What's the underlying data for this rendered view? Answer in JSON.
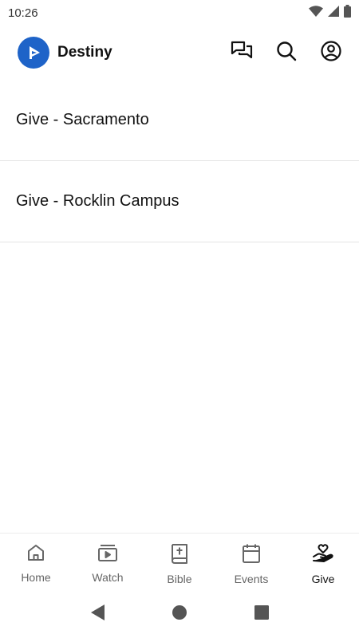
{
  "status_bar": {
    "time": "10:26"
  },
  "header": {
    "app_name": "Destiny"
  },
  "giving_options": [
    {
      "label": "Give - Sacramento"
    },
    {
      "label": "Give - Rocklin Campus"
    }
  ],
  "bottom_nav": {
    "items": [
      {
        "label": "Home",
        "icon": "home-icon"
      },
      {
        "label": "Watch",
        "icon": "video-play-icon"
      },
      {
        "label": "Bible",
        "icon": "bible-icon"
      },
      {
        "label": "Events",
        "icon": "calendar-icon"
      },
      {
        "label": "Give",
        "icon": "heart-hand-icon"
      }
    ],
    "active": "Give"
  },
  "colors": {
    "brand": "#1e63c8",
    "divider": "#e4e4e4",
    "inactive": "#666666",
    "active": "#111111"
  }
}
